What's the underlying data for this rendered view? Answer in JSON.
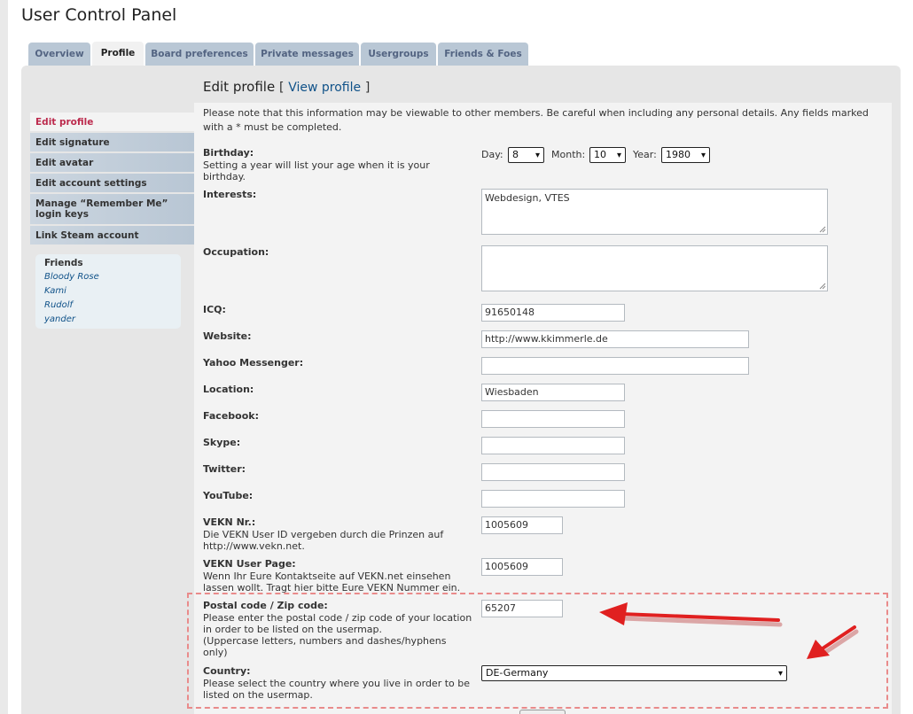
{
  "header": {
    "title": "User Control Panel"
  },
  "tabs": [
    {
      "label": "Overview",
      "active": false
    },
    {
      "label": "Profile",
      "active": true
    },
    {
      "label": "Board preferences",
      "active": false
    },
    {
      "label": "Private messages",
      "active": false
    },
    {
      "label": "Usergroups",
      "active": false
    },
    {
      "label": "Friends & Foes",
      "active": false
    }
  ],
  "sidebar": {
    "items": [
      {
        "label": "Edit profile",
        "active": true
      },
      {
        "label": "Edit signature"
      },
      {
        "label": "Edit avatar"
      },
      {
        "label": "Edit account settings"
      },
      {
        "label": "Manage “Remember Me” login keys"
      },
      {
        "label": "Link Steam account"
      }
    ],
    "friends": {
      "title": "Friends",
      "names": [
        "Bloody Rose",
        "Kami",
        "Rudolf",
        "yander"
      ]
    }
  },
  "main": {
    "title": "Edit profile",
    "bracket_open": "[",
    "bracket_close": "]",
    "view_profile_link": "View profile",
    "note": "Please note that this information may be viewable to other members. Be careful when including any personal details. Any fields marked with a * must be completed.",
    "birthday": {
      "label": "Birthday:",
      "explain": "Setting a year will list your age when it is your birthday.",
      "day_label": "Day:",
      "day_value": "8",
      "month_label": "Month:",
      "month_value": "10",
      "year_label": "Year:",
      "year_value": "1980"
    },
    "interests": {
      "label": "Interests:",
      "value": "Webdesign, VTES"
    },
    "occupation": {
      "label": "Occupation:",
      "value": ""
    },
    "icq": {
      "label": "ICQ:",
      "value": "91650148"
    },
    "website": {
      "label": "Website:",
      "value": "http://www.kkimmerle.de"
    },
    "yahoo": {
      "label": "Yahoo Messenger:",
      "value": ""
    },
    "location": {
      "label": "Location:",
      "value": "Wiesbaden"
    },
    "facebook": {
      "label": "Facebook:",
      "value": ""
    },
    "skype": {
      "label": "Skype:",
      "value": ""
    },
    "twitter": {
      "label": "Twitter:",
      "value": ""
    },
    "youtube": {
      "label": "YouTube:",
      "value": ""
    },
    "vekn_nr": {
      "label": "VEKN Nr.:",
      "explain": "Die VEKN User ID vergeben durch die Prinzen auf http://www.vekn.net.",
      "value": "1005609"
    },
    "vekn_page": {
      "label": "VEKN User Page:",
      "explain": "Wenn Ihr Eure Kontaktseite auf VEKN.net einsehen lassen wollt. Tragt hier bitte Eure VEKN Nummer ein.",
      "value": "1005609"
    },
    "postal": {
      "label": "Postal code / Zip code:",
      "explain": "Please enter the postal code / zip code of your location in order to be listed on the usermap.",
      "explain2": "(Uppercase letters, numbers and dashes/hyphens only)",
      "value": "65207"
    },
    "country": {
      "label": "Country:",
      "explain": "Please select the country where you live in order to be listed on the usermap.",
      "value": "DE-Germany"
    }
  },
  "colors": {
    "tab_bg": "#b9c7d5",
    "link": "#105289",
    "active_menu": "#bc2a4d",
    "annotation_arrow": "#e02020",
    "highlight_border": "#e98b8b"
  }
}
